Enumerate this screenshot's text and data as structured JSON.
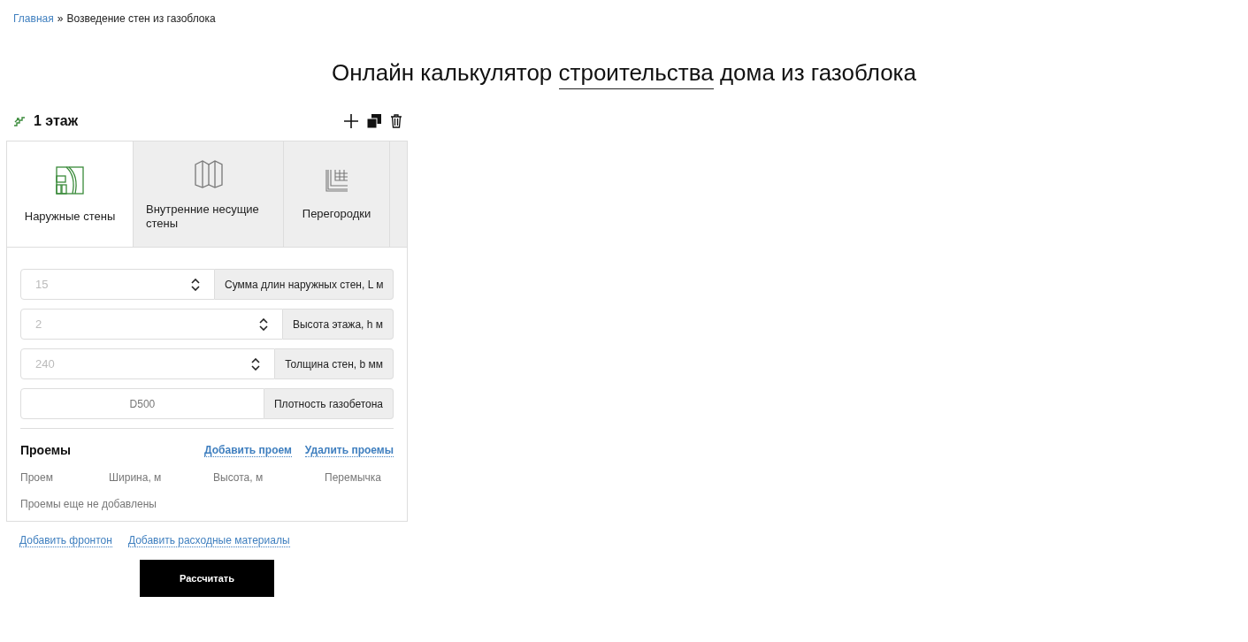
{
  "breadcrumbs": {
    "links": [
      {
        "label": "Главная"
      }
    ],
    "separator": "»",
    "current": "Возведение стен из газоблока"
  },
  "title": [
    {
      "text": "Онлайн калькулятор ",
      "underlined": false
    },
    {
      "text": "строительства",
      "underlined": true
    },
    {
      "text": " дома из газоблока",
      "underlined": false
    }
  ],
  "floor": {
    "title": "1 этаж"
  },
  "tabs": [
    {
      "label": "Наружные стены",
      "kind": "outer",
      "selected": true
    },
    {
      "label": "Внутренние несущие стены",
      "kind": "inner",
      "selected": false
    },
    {
      "label": "Перегородки",
      "kind": "partition",
      "selected": false
    }
  ],
  "fields": [
    {
      "kind": "number",
      "placeholder": "15",
      "label": "Сумма длин наружных стен, L м"
    },
    {
      "kind": "number",
      "placeholder": "2",
      "label": "Высота этажа, h м"
    },
    {
      "kind": "number",
      "placeholder": "240",
      "label": "Толщина стен, b мм"
    },
    {
      "kind": "select",
      "value": "D500",
      "label": "Плотность газобетона"
    }
  ],
  "openings": {
    "title": "Проемы",
    "actions": [
      "Добавить проем",
      "Удалить проемы"
    ],
    "columns": [
      "Проем",
      "Ширина, м",
      "Высота, м",
      "Перемычка"
    ],
    "empty": "Проемы еще не добавлены"
  },
  "links": [
    "Добавить фронтон",
    "Добавить расходные материалы"
  ],
  "submit": "Рассчитать"
}
